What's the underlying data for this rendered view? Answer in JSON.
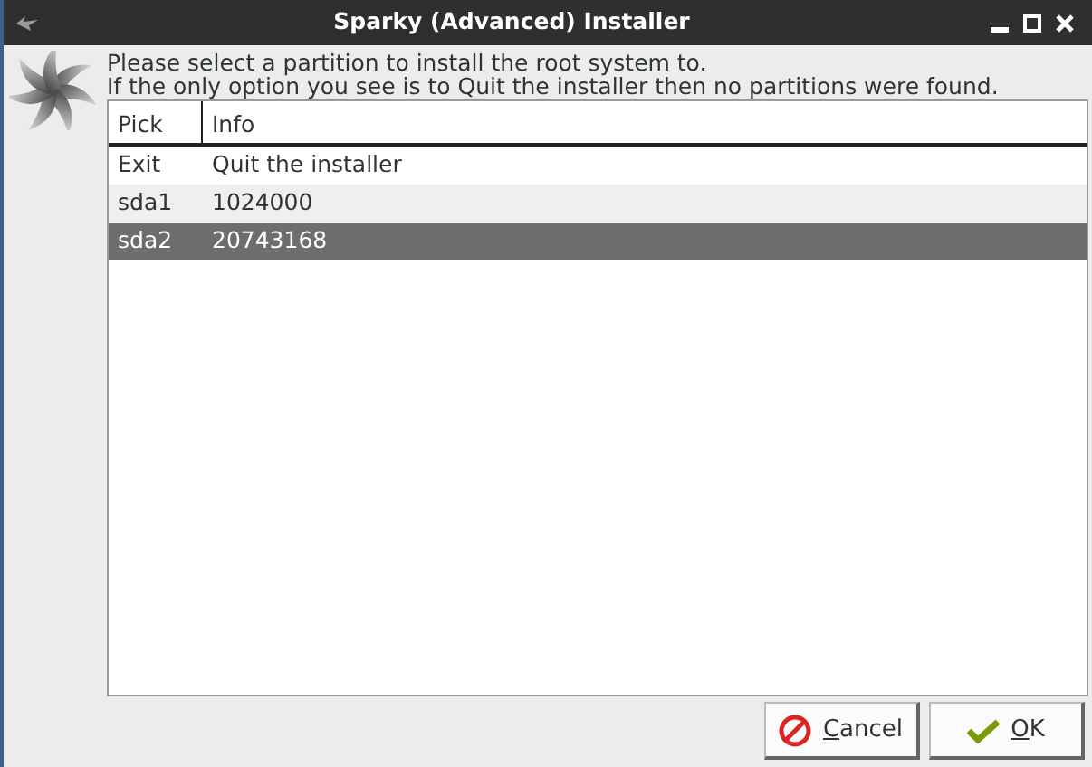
{
  "window": {
    "title": "Sparky (Advanced) Installer"
  },
  "message": [
    "Please select a partition to install the root system to.",
    "If the only option you see is to Quit the installer then no partitions were found."
  ],
  "table": {
    "columns": [
      "Pick",
      "Info"
    ],
    "rows": [
      {
        "cells": [
          "Exit",
          "Quit the installer"
        ],
        "selected": false
      },
      {
        "cells": [
          "sda1",
          "1024000"
        ],
        "selected": false
      },
      {
        "cells": [
          "sda2",
          "20743168"
        ],
        "selected": true
      }
    ]
  },
  "buttons": [
    {
      "kind": "cancel",
      "label": "Cancel",
      "mnemonic": true
    },
    {
      "kind": "ok",
      "label": "OK",
      "mnemonic": true
    }
  ]
}
